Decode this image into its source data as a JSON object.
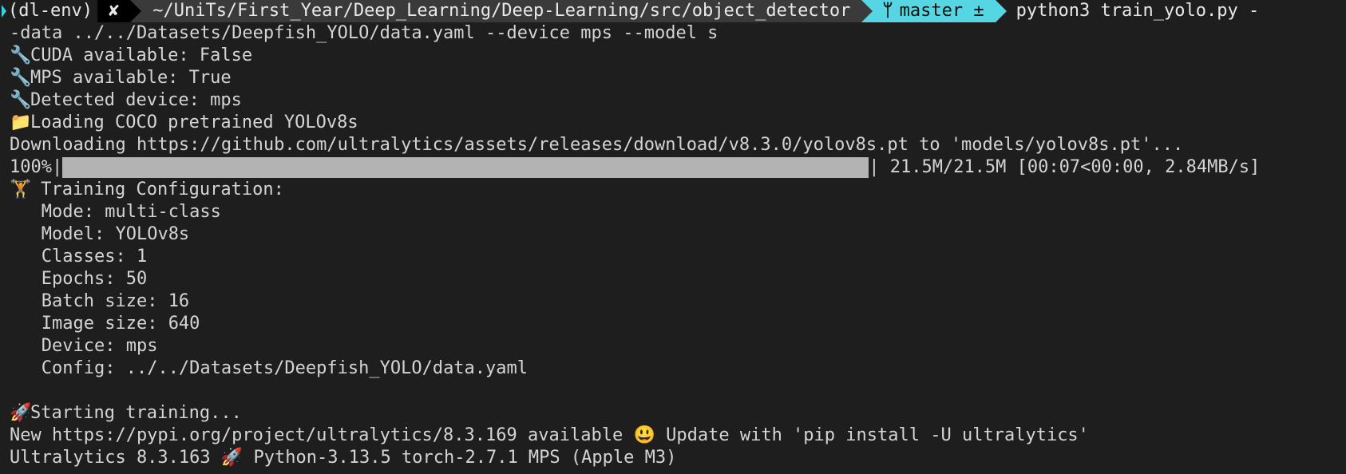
{
  "prompt": {
    "env": "(dl-env)",
    "status_symbol": "✘",
    "path": "~/UniTs/First_Year/Deep_Learning/Deep-Learning/src/object_detector",
    "branch": "master ±",
    "command": "python3 train_yolo.py -",
    "command_cont": "-data ../../Datasets/Deepfish_YOLO/data.yaml --device mps --model s"
  },
  "colors": {
    "background": "#1e1e1e",
    "text": "#d4d4d4",
    "path_segment": "#3a3a3a",
    "branch_segment": "#56d6e3",
    "progress_fill": "#b3b3b3"
  },
  "output": {
    "cuda": {
      "icon": "🔧",
      "text": "CUDA available: False"
    },
    "mps": {
      "icon": "🔧",
      "text": "MPS available: True"
    },
    "device": {
      "icon": "🔧",
      "text": "Detected device: mps"
    },
    "loading": {
      "icon": "📁",
      "text": "Loading COCO pretrained YOLOv8s"
    },
    "downloading": "Downloading https://github.com/ultralytics/assets/releases/download/v8.3.0/yolov8s.pt to 'models/yolov8s.pt'...",
    "progress": {
      "percent_label": "100%|",
      "fraction": 1.0,
      "stats": "| 21.5M/21.5M [00:07<00:00, 2.84MB/s]"
    },
    "config": {
      "icon": "🏋",
      "title": " Training Configuration:",
      "lines": [
        "Mode: multi-class",
        "Model: YOLOv8s",
        "Classes: 1",
        "Epochs: 50",
        "Batch size: 16",
        "Image size: 640",
        "Device: mps",
        "Config: ../../Datasets/Deepfish_YOLO/data.yaml"
      ]
    },
    "start": {
      "icon": "🚀",
      "text": "Starting training..."
    },
    "new_version": {
      "before": "New https://pypi.org/project/ultralytics/8.3.169 available ",
      "icon": "😃",
      "after": " Update with 'pip install -U ultralytics'"
    },
    "ultralytics": {
      "before": "Ultralytics 8.3.163 ",
      "icon": "🚀",
      "after": " Python-3.13.5 torch-2.7.1 MPS (Apple M3)"
    }
  }
}
